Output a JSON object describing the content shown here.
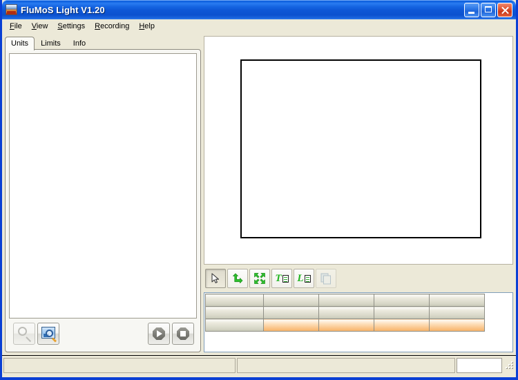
{
  "window": {
    "title": "FluMoS Light V1.20",
    "icon": "app-logo-icon",
    "controls": {
      "minimize": "minimize-icon",
      "maximize": "maximize-icon",
      "close": "close-icon"
    },
    "colors": {
      "titlebar_blue": "#0f5fd8",
      "frame_blue": "#0a3fd4",
      "face": "#ece9d8",
      "accent_orange": "#f9bc79",
      "icon_green": "#22b522"
    }
  },
  "menubar": {
    "items": [
      {
        "label": "File",
        "accel_prefix": "F",
        "accel_rest": "ile"
      },
      {
        "label": "View",
        "accel_prefix": "V",
        "accel_rest": "iew"
      },
      {
        "label": "Settings",
        "accel_prefix": "S",
        "accel_rest": "ettings"
      },
      {
        "label": "Recording",
        "accel_prefix": "R",
        "accel_rest": "ecording"
      },
      {
        "label": "Help",
        "accel_prefix": "H",
        "accel_rest": "elp"
      }
    ]
  },
  "left_panel": {
    "tabs": [
      {
        "label": "Units",
        "active": true
      },
      {
        "label": "Limits",
        "active": false
      },
      {
        "label": "Info",
        "active": false
      }
    ],
    "unit_list": {
      "items": [],
      "empty": true
    },
    "buttons": [
      {
        "name": "zoom-out-button",
        "icon": "magnifier-icon",
        "enabled": false
      },
      {
        "name": "zoom-region-button",
        "icon": "picture-magnifier-icon",
        "enabled": true
      },
      {
        "name": "play-button",
        "icon": "play-icon",
        "enabled": true
      },
      {
        "name": "stop-button",
        "icon": "stop-icon",
        "enabled": true
      }
    ]
  },
  "graph": {
    "plot": {
      "empty": true,
      "border_color": "#000000",
      "background": "#ffffff"
    },
    "toolbar": [
      {
        "name": "select-tool",
        "icon": "cursor-arrow-icon",
        "state": "pressed",
        "enabled": true
      },
      {
        "name": "pan-tool",
        "icon": "move-arrows-icon",
        "state": "normal",
        "enabled": true
      },
      {
        "name": "zoom-fit-tool",
        "icon": "expand-arrows-icon",
        "state": "normal",
        "enabled": true
      },
      {
        "name": "text-tool",
        "icon": "t-document-icon",
        "state": "normal",
        "enabled": true,
        "letter": "T"
      },
      {
        "name": "legend-tool",
        "icon": "l-document-icon",
        "state": "normal",
        "enabled": true,
        "letter": "L"
      },
      {
        "name": "copy-tool",
        "icon": "copy-icon",
        "state": "normal",
        "enabled": false
      }
    ]
  },
  "table": {
    "columns": [
      "",
      "",
      "",
      "",
      ""
    ],
    "rows": [
      {
        "type": "header",
        "cells": [
          "",
          "",
          "",
          "",
          ""
        ]
      },
      {
        "type": "header",
        "cells": [
          "",
          "",
          "",
          "",
          ""
        ]
      },
      {
        "type": "value",
        "cells": [
          "",
          "",
          "",
          "",
          ""
        ]
      }
    ]
  },
  "statusbar": {
    "panes": [
      {
        "name": "status-message",
        "text": ""
      },
      {
        "name": "status-detail",
        "text": ""
      },
      {
        "name": "status-value",
        "text": ""
      }
    ]
  }
}
